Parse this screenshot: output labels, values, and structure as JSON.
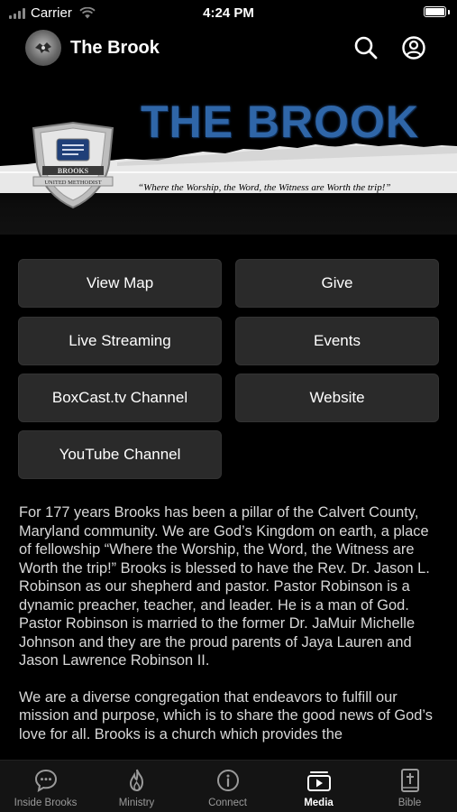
{
  "status_bar": {
    "carrier": "Carrier",
    "time": "4:24 PM"
  },
  "nav": {
    "title": "The Brook",
    "icons": [
      "logo-icon",
      "search-icon",
      "account-icon"
    ]
  },
  "banner": {
    "title": "THE BROOK",
    "crest_text_top": "BROOKS",
    "crest_text_bottom": "UNITED METHODIST",
    "tagline": "“Where the Worship, the Word, the Witness are Worth the trip!”"
  },
  "buttons": {
    "view_map": "View Map",
    "give": "Give",
    "live_streaming": "Live Streaming",
    "events": "Events",
    "boxcast": "BoxCast.tv Channel",
    "website": "Website",
    "youtube": "YouTube Channel"
  },
  "about": {
    "paragraph1": "For 177 years Brooks has been a pillar of the Calvert County, Maryland community. We are God’s Kingdom on earth, a place of fellowship “Where the Worship, the Word, the Witness are Worth the trip!” Brooks is blessed to have the Rev. Dr. Jason L. Robinson as our shepherd and pastor. Pastor Robinson is a dynamic preacher, teacher, and leader. He is a man of God. Pastor Robinson is married to the former Dr. JaMuir Michelle Johnson and they are the proud parents of Jaya Lauren and Jason Lawrence Robinson II.",
    "paragraph2": "We are a diverse congregation that endeavors to fulfill our mission and purpose, which is to share the good news of God’s love for all. Brooks is a church which provides the"
  },
  "tabs": [
    {
      "label": "Inside Brooks",
      "icon": "chat-bubble-icon",
      "active": false
    },
    {
      "label": "Ministry",
      "icon": "flame-icon",
      "active": false
    },
    {
      "label": "Connect",
      "icon": "info-icon",
      "active": false
    },
    {
      "label": "Media",
      "icon": "media-icon",
      "active": true
    },
    {
      "label": "Bible",
      "icon": "bible-icon",
      "active": false
    }
  ],
  "colors": {
    "background": "#000000",
    "button": "#2a2a2a",
    "banner_title": "#2f66a8",
    "tab_active": "#ffffff",
    "tab_inactive": "#9a9a9a"
  }
}
